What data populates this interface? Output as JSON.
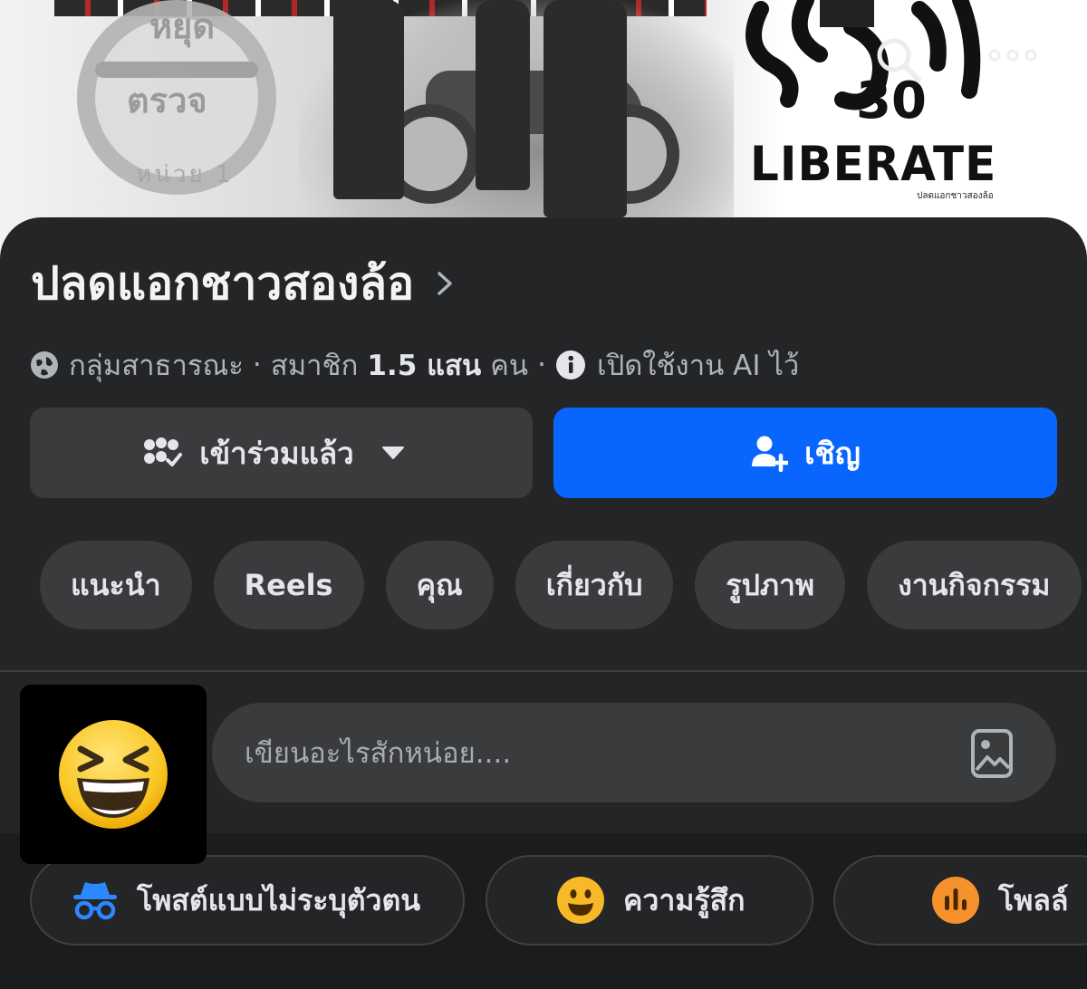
{
  "app": {
    "name": "Facebook",
    "theme": "dark"
  },
  "colors": {
    "background": "#242526",
    "accent": "#0866ff",
    "button": "#3a3b3c",
    "muted_text": "#b0b3b8"
  },
  "cover": {
    "logo_text": "LIBERATE",
    "logo_caption": "ปลดแอกชาวสองล้อ",
    "sign_words": [
      "หยุด",
      "ตรวจ"
    ],
    "sign_sub": "หน่วย 1"
  },
  "top_bar": {
    "back_icon": "chevron-left-icon",
    "search_icon": "search-icon",
    "more_icon": "more-horizontal-icon"
  },
  "group": {
    "name": "ปลดแอกชาวสองล้อ",
    "privacy": "กลุ่มสาธารณะ",
    "members_prefix": "สมาชิก",
    "member_count": "1.5 แสน",
    "members_suffix": "คน",
    "ai_status": "เปิดใช้งาน AI ไว้",
    "separator": "·"
  },
  "actions": {
    "joined_label": "เข้าร่วมแล้ว",
    "invite_label": "เชิญ"
  },
  "tabs": [
    "แนะนำ",
    "Reels",
    "คุณ",
    "เกี่ยวกับ",
    "รูปภาพ",
    "งานกิจกรรม"
  ],
  "composer": {
    "placeholder": "เขียนอะไรสักหน่อย....",
    "avatar_emoji": "😆"
  },
  "quick_actions": {
    "anonymous": "โพสต์แบบไม่ระบุตัวตน",
    "feeling": "ความรู้สึก",
    "poll": "โพลล์"
  }
}
